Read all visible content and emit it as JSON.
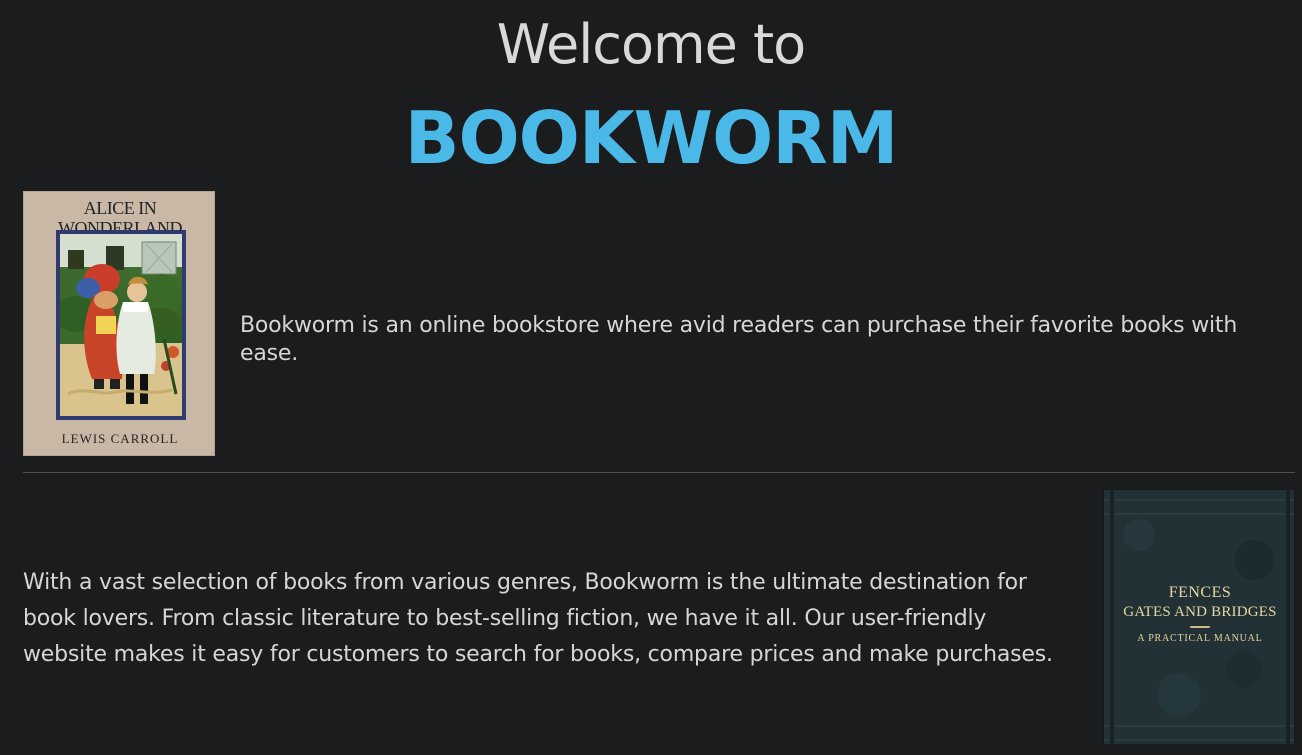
{
  "header": {
    "welcome": "Welcome to",
    "brand": "BOOKWORM",
    "brand_color": "#4ab9e8"
  },
  "section1": {
    "text": "Bookworm is an online bookstore where avid readers can purchase their favorite books with ease.",
    "cover": {
      "title": "ALICE IN WONDERLAND",
      "author": "LEWIS CARROLL"
    }
  },
  "section2": {
    "text": "With a vast selection of books from various genres, Bookworm is the ultimate destination for book lovers. From classic literature to best-selling fiction, we have it all. Our user-friendly website makes it easy for customers to search for books, compare prices and make purchases.",
    "cover": {
      "line1": "FENCES",
      "line2": "GATES AND BRIDGES",
      "line3": "A PRACTICAL MANUAL"
    }
  }
}
